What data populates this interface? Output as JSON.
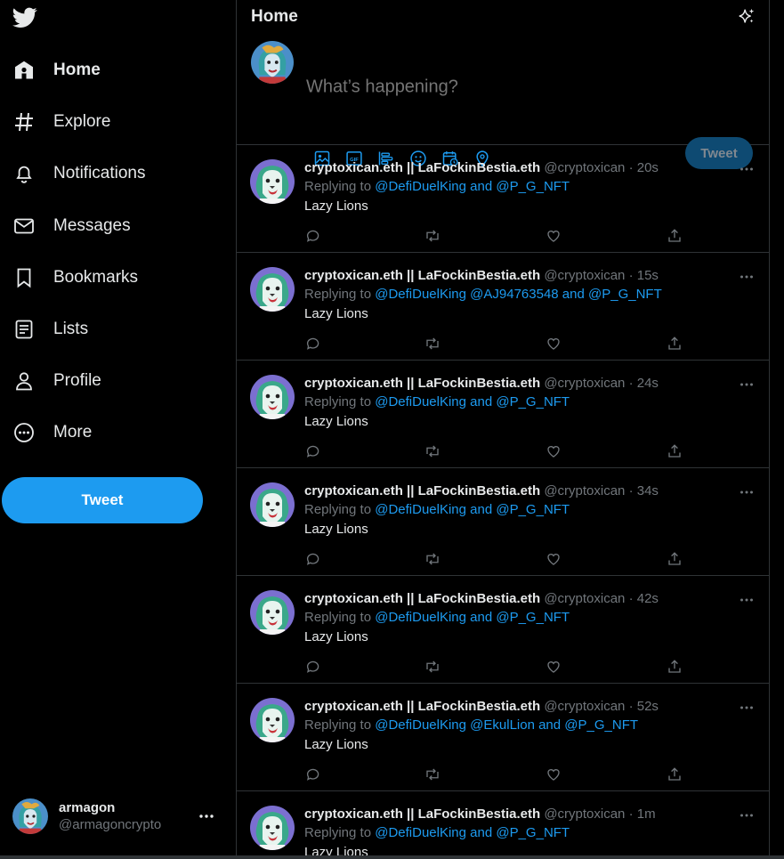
{
  "colors": {
    "accent": "#1d9bf0",
    "background": "#000000",
    "text": "#e7e9ea",
    "muted": "#71767b",
    "border": "#2f3336"
  },
  "sidebar": {
    "logo_icon": "twitter-bird-icon",
    "items": [
      {
        "label": "Home",
        "icon": "home-icon",
        "active": true
      },
      {
        "label": "Explore",
        "icon": "hashtag-icon"
      },
      {
        "label": "Notifications",
        "icon": "bell-icon"
      },
      {
        "label": "Messages",
        "icon": "envelope-icon"
      },
      {
        "label": "Bookmarks",
        "icon": "bookmark-icon"
      },
      {
        "label": "Lists",
        "icon": "list-icon"
      },
      {
        "label": "Profile",
        "icon": "person-icon"
      },
      {
        "label": "More",
        "icon": "more-circle-icon"
      }
    ],
    "tweet_button": "Tweet",
    "account": {
      "name": "armagon",
      "handle": "@armagoncrypto"
    }
  },
  "header": {
    "title": "Home"
  },
  "composer": {
    "placeholder": "What’s happening?",
    "tools": [
      "image-icon",
      "gif-icon",
      "poll-icon",
      "emoji-icon",
      "schedule-icon",
      "location-icon"
    ],
    "tweet_button": "Tweet"
  },
  "tweets": [
    {
      "name": "cryptoxican.eth || LaFockinBestia.eth",
      "handle": "@cryptoxican",
      "time": "20s",
      "replying_prefix": "Replying to",
      "mentions": "@DefiDuelKing and @P_G_NFT",
      "text": "Lazy Lions"
    },
    {
      "name": "cryptoxican.eth || LaFockinBestia.eth",
      "handle": "@cryptoxican",
      "time": "15s",
      "replying_prefix": "Replying to",
      "mentions": "@DefiDuelKing @AJ94763548 and @P_G_NFT",
      "text": "Lazy Lions"
    },
    {
      "name": "cryptoxican.eth || LaFockinBestia.eth",
      "handle": "@cryptoxican",
      "time": "24s",
      "replying_prefix": "Replying to",
      "mentions": "@DefiDuelKing and @P_G_NFT",
      "text": "Lazy Lions"
    },
    {
      "name": "cryptoxican.eth || LaFockinBestia.eth",
      "handle": "@cryptoxican",
      "time": "34s",
      "replying_prefix": "Replying to",
      "mentions": "@DefiDuelKing and @P_G_NFT",
      "text": "Lazy Lions"
    },
    {
      "name": "cryptoxican.eth || LaFockinBestia.eth",
      "handle": "@cryptoxican",
      "time": "42s",
      "replying_prefix": "Replying to",
      "mentions": "@DefiDuelKing and @P_G_NFT",
      "text": "Lazy Lions"
    },
    {
      "name": "cryptoxican.eth || LaFockinBestia.eth",
      "handle": "@cryptoxican",
      "time": "52s",
      "replying_prefix": "Replying to",
      "mentions": "@DefiDuelKing @EkulLion and @P_G_NFT",
      "text": "Lazy Lions"
    },
    {
      "name": "cryptoxican.eth || LaFockinBestia.eth",
      "handle": "@cryptoxican",
      "time": "1m",
      "replying_prefix": "Replying to",
      "mentions": "@DefiDuelKing and @P_G_NFT",
      "text": "Lazy Lions"
    }
  ]
}
